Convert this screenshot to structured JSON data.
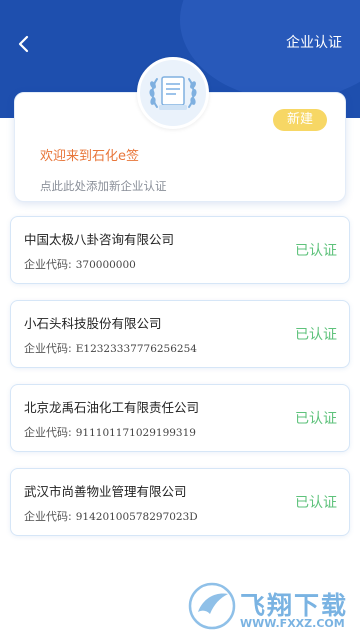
{
  "header": {
    "title": "企业认证",
    "back_icon": "chevron-left-icon"
  },
  "welcome_card": {
    "title": "欢迎来到石化e签",
    "hint": "点此此处添加新企业认证",
    "new_button": "新建",
    "emblem_icon": "certificate-laurel-icon"
  },
  "companies": [
    {
      "name": "中国太极八卦咨询有限公司",
      "code_label": "企业代码:",
      "code": "370000000",
      "status": "已认证"
    },
    {
      "name": "小石头科技股份有限公司",
      "code_label": "企业代码:",
      "code": "E12323337776256254",
      "status": "已认证"
    },
    {
      "name": "北京龙禹石油化工有限责任公司",
      "code_label": "企业代码:",
      "code": "911101171029199319",
      "status": "已认证"
    },
    {
      "name": "武汉市尚善物业管理有限公司",
      "code_label": "企业代码:",
      "code": "91420100578297023D",
      "status": "已认证"
    }
  ],
  "watermark": {
    "text": "飞翔下载",
    "url": "WWW.FXXZ.COM"
  },
  "colors": {
    "header": "#1e4fae",
    "accent_orange": "#e8763a",
    "status_green": "#5ec27b",
    "new_button": "#f7d765"
  }
}
